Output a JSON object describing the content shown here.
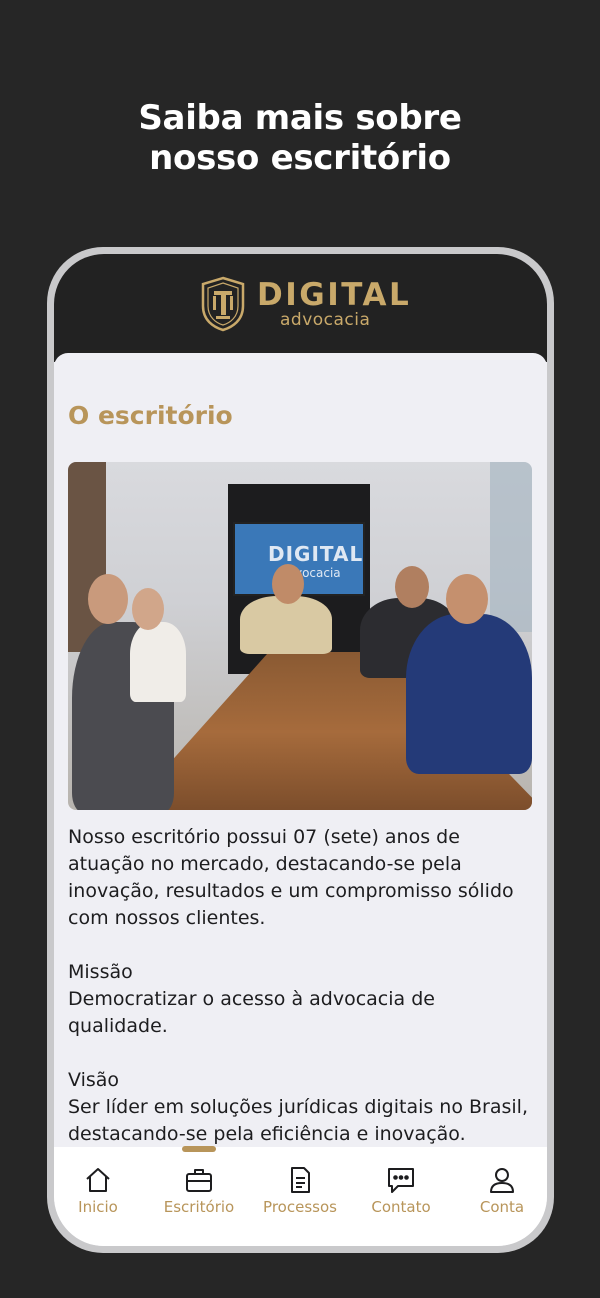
{
  "promo": {
    "line1": "Saiba mais sobre",
    "line2": "nosso escritório"
  },
  "header": {
    "logo_title": "DIGITAL",
    "logo_subtitle": "advocacia"
  },
  "main": {
    "title": "O escritório",
    "photo_screen_title": "DIGITAL",
    "photo_screen_subtitle": "advocacia",
    "paragraphs": [
      "Nosso escritório possui 07 (sete) anos de atuação no mercado, destacando-se pela inovação, resultados e um compromisso sólido com nossos clientes.",
      "Missão",
      "Democratizar o acesso à advocacia de qualidade.",
      "Visão",
      "Ser líder em soluções jurídicas digitais no Brasil, destacando-se pela eficiência e inovação."
    ]
  },
  "tabbar": {
    "active": 1,
    "tabs": [
      {
        "label": "Inicio",
        "icon": "home-icon"
      },
      {
        "label": "Escritório",
        "icon": "briefcase-icon"
      },
      {
        "label": "Processos",
        "icon": "document-icon"
      },
      {
        "label": "Contato",
        "icon": "chat-icon"
      },
      {
        "label": "Conta",
        "icon": "user-icon"
      }
    ]
  },
  "colors": {
    "background": "#262626",
    "accent": "#b8955a",
    "header": "#222222",
    "content_bg": "#efeff4"
  }
}
